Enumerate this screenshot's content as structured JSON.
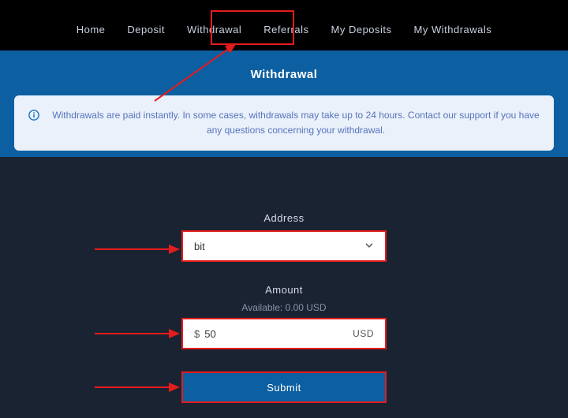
{
  "nav": {
    "items": [
      "Home",
      "Deposit",
      "Withdrawal",
      "Referrals",
      "My Deposits",
      "My Withdrawals"
    ],
    "active_index": 2
  },
  "page": {
    "title": "Withdrawal"
  },
  "notice": {
    "icon_name": "info-icon",
    "text": "Withdrawals are paid instantly. In some cases, withdrawals may take up to 24 hours. Contact our support if you have any questions concerning your withdrawal."
  },
  "form": {
    "address": {
      "label": "Address",
      "selected": "bit"
    },
    "amount": {
      "label": "Amount",
      "available_label": "Available: 0.00 USD",
      "currency_prefix": "$",
      "value": "50",
      "currency_suffix": "USD"
    },
    "submit_label": "Submit"
  },
  "annotation": {
    "highlight_color": "#e51c1c"
  }
}
